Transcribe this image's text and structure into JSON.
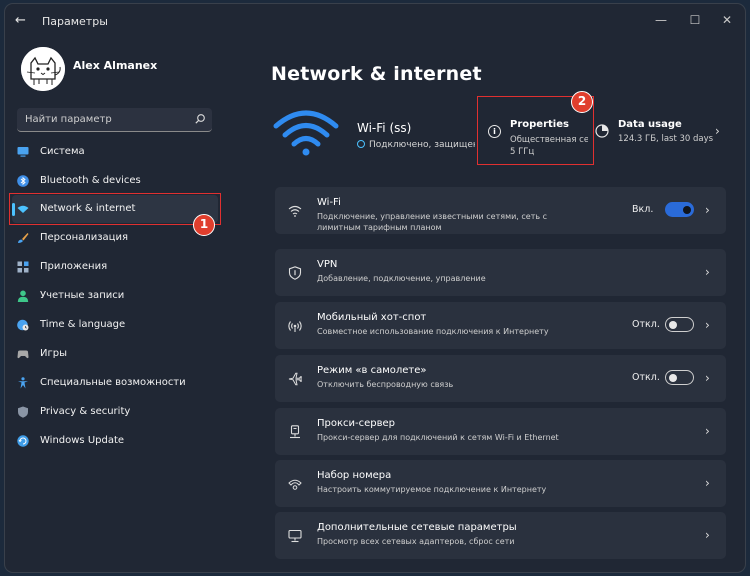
{
  "window": {
    "title": "Параметры",
    "back_glyph": "←",
    "minimize": "—",
    "maximize": "☐",
    "close": "✕"
  },
  "user": {
    "name": "Alex Almanex"
  },
  "search": {
    "placeholder": "Найти параметр"
  },
  "sidebar": {
    "items": [
      {
        "label": "Система",
        "icon": "monitor-icon",
        "color": "#4aa3f0"
      },
      {
        "label": "Bluetooth & devices",
        "icon": "bluetooth-icon",
        "color": "#3f8fe8"
      },
      {
        "label": "Network & internet",
        "icon": "wifi-diamond-icon",
        "color": "#4cc2ff"
      },
      {
        "label": "Персонализация",
        "icon": "brush-icon",
        "color": "#e8a24a"
      },
      {
        "label": "Приложения",
        "icon": "apps-icon",
        "color": "#9fb2c8"
      },
      {
        "label": "Учетные записи",
        "icon": "person-icon",
        "color": "#3ec78a"
      },
      {
        "label": "Time & language",
        "icon": "globe-clock-icon",
        "color": "#4aa3f0"
      },
      {
        "label": "Игры",
        "icon": "gamepad-icon",
        "color": "#a8a8a8"
      },
      {
        "label": "Специальные возможности",
        "icon": "accessibility-icon",
        "color": "#4aa3f0"
      },
      {
        "label": "Privacy & security",
        "icon": "shield-icon",
        "color": "#8a95a5"
      },
      {
        "label": "Windows Update",
        "icon": "update-icon",
        "color": "#3f9de8"
      }
    ],
    "active_index": 2
  },
  "annotations": {
    "badge1": "1",
    "badge2": "2"
  },
  "main": {
    "title": "Network & internet",
    "wifi": {
      "name": "Wi-Fi (ss)",
      "status": "Подключено, защищено"
    },
    "properties": {
      "title": "Properties",
      "line1": "Общественная сеть",
      "line2": "5 ГГц"
    },
    "data_usage": {
      "title": "Data usage",
      "subtitle": "124.3 ГБ, last 30 days"
    },
    "cards": [
      {
        "title": "Wi-Fi",
        "subtitle": "Подключение, управление известными сетями, сеть с лимитным тарифным планом",
        "state": "Вкл.",
        "toggle": "on",
        "icon": "wifi-icon"
      },
      {
        "title": "VPN",
        "subtitle": "Добавление, подключение, управление",
        "state": "",
        "toggle": "",
        "icon": "vpn-shield-icon"
      },
      {
        "title": "Мобильный хот-спот",
        "subtitle": "Совместное использование подключения к Интернету",
        "state": "Откл.",
        "toggle": "off",
        "icon": "hotspot-icon"
      },
      {
        "title": "Режим «в самолете»",
        "subtitle": "Отключить беспроводную связь",
        "state": "Откл.",
        "toggle": "off",
        "icon": "airplane-icon"
      },
      {
        "title": "Прокси-сервер",
        "subtitle": "Прокси-сервер для подключений к сетям Wi-Fi и Ethernet",
        "state": "",
        "toggle": "",
        "icon": "proxy-icon"
      },
      {
        "title": "Набор номера",
        "subtitle": "Настроить коммутируемое подключение к Интернету",
        "state": "",
        "toggle": "",
        "icon": "dialup-icon"
      },
      {
        "title": "Дополнительные сетевые параметры",
        "subtitle": "Просмотр всех сетевых адаптеров, сброс сети",
        "state": "",
        "toggle": "",
        "icon": "network-pc-icon"
      }
    ]
  },
  "colors": {
    "accent": "#4cc2ff",
    "annotation": "#e03030",
    "toggle_on": "#2a6bd9"
  }
}
